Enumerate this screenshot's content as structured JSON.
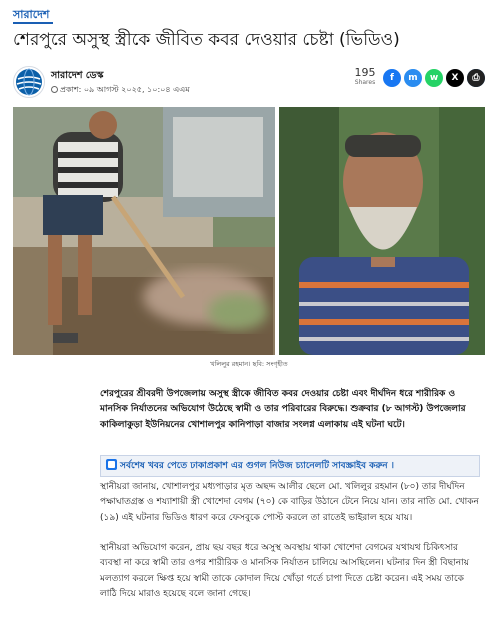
{
  "category": "সারাদেশ",
  "headline": "শেরপুরে অসুস্থ স্ত্রীকে জীবিত কবর দেওয়ার চেষ্টা (ভিডিও)",
  "author": {
    "name": "সারাদেশ ডেস্ক",
    "published": "প্রকাশ: ০৯ আগস্ট ২০২৫, ১০:০৪ এএম"
  },
  "share": {
    "count": "195",
    "label": "Shares",
    "buttons": [
      {
        "name": "facebook",
        "glyph": "f",
        "color": "#1877f2"
      },
      {
        "name": "messenger",
        "glyph": "m",
        "color": "#2a8cf0"
      },
      {
        "name": "whatsapp",
        "glyph": "w",
        "color": "#25d366"
      },
      {
        "name": "x",
        "glyph": "X",
        "color": "#000000"
      },
      {
        "name": "linkedin",
        "glyph": "in",
        "color": "#0a66c2"
      },
      {
        "name": "print",
        "glyph": "⎙",
        "color": "#222222"
      }
    ]
  },
  "photo": {
    "caption": "খলিলুর রহমান। ছবি: সংগৃহীত"
  },
  "article": {
    "lead": "শেরপুরের শ্রীবরদী উপজেলায় অসুস্থ স্ত্রীকে জীবিত কবর দেওয়ার চেষ্টা এবং দীর্ঘদিন ধরে শারীরিক ও মানসিক নির্যাতনের অভিযোগ উঠেছে স্বামী ও তার পরিবারের বিরুদ্ধে। শুক্রবার (৮ আগস্ট) উপজেলার কাকিলাকুড়া ইউনিয়নের খোশালপুর কানিপাড়া বাজার সংলগ্ন এলাকায় এই ঘটনা ঘটে।",
    "promo": "সর্বশেষ খবর পেতে ঢাকাপ্রকাশ এর গুগল নিউজ চ্যানেলটি সাবস্ক্রাইব করুন ।",
    "para1": "স্থানীয়রা জানায়, খোশালপুর মধ্যপাড়ার মৃত অছদ্দ আলীর ছেলে মো. খলিলুর রহমান (৮০) তার দীর্ঘদিন পক্ষাঘাতগ্রস্ত ও শয্যাশায়ী স্ত্রী খোশেদা বেগম (৭০) কে বাড়ির উঠানে টেনে নিয়ে যান। তার নাতি মো. খোকন (১৯) এই ঘটনার ভিডিও ধারণ করে ফেসবুকে পোস্ট করলে তা রাতেই ভাইরাল হয়ে যায়।",
    "para2": "স্থানীয়রা অভিযোগ করেন, প্রায় ছয় বছর ধরে অসুস্থ অবস্থায় থাকা খোশেদা বেগমের যথাযথ চিকিৎসার ব্যবস্থা না করে স্বামী তার ওপর শারীরিক ও মানসিক নির্যাতন চালিয়ে আসছিলেন। ঘটনার দিন স্ত্রী বিছানায় মলত্যাগ করলে ক্ষিপ্ত হয়ে স্বামী তাকে কোদাল দিয়ে খোঁড়া গর্তে চাপা দিতে চেষ্টা করেন। এই সময় তাকে লাঠি দিয়ে মারাও হয়েছে বলে জানা গেছে।"
  }
}
